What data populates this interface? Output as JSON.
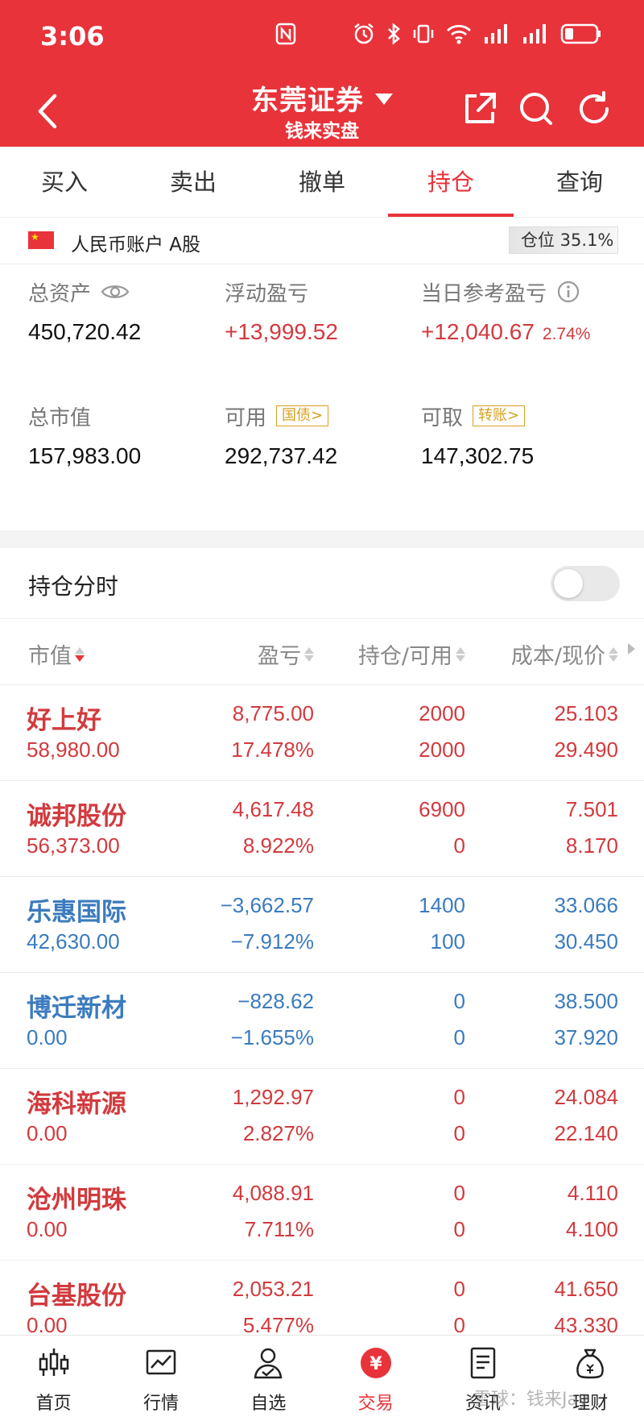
{
  "status_bar": {
    "time": "3:06"
  },
  "header": {
    "title": "东莞证券",
    "subtitle": "钱来实盘"
  },
  "tabs": [
    {
      "label": "买入",
      "active": false
    },
    {
      "label": "卖出",
      "active": false
    },
    {
      "label": "撤单",
      "active": false
    },
    {
      "label": "持仓",
      "active": true
    },
    {
      "label": "查询",
      "active": false
    }
  ],
  "account": {
    "label": "人民币账户 A股",
    "position_ratio": "仓位 35.1%"
  },
  "summary": {
    "total_assets_label": "总资产",
    "total_assets": "450,720.42",
    "floating_pl_label": "浮动盈亏",
    "floating_pl": "+13,999.52",
    "daily_pl_label": "当日参考盈亏",
    "daily_pl": "+12,040.67",
    "daily_pl_pct": "2.74%",
    "market_value_label": "总市值",
    "market_value": "157,983.00",
    "available_label": "可用",
    "available_tag": "国债>",
    "available": "292,737.42",
    "withdrawable_label": "可取",
    "withdrawable_tag": "转账>",
    "withdrawable": "147,302.75"
  },
  "timeshare": {
    "label": "持仓分时",
    "enabled": false
  },
  "table": {
    "headers": {
      "market_value": "市值",
      "pl": "盈亏",
      "holding": "持仓/可用",
      "cost": "成本/现价"
    },
    "rows": [
      {
        "name": "好上好",
        "mv": "58,980.00",
        "pl": "8,775.00",
        "pl_pct": "17.478%",
        "hold": "2000",
        "avail": "2000",
        "cost": "25.103",
        "price": "29.490",
        "color": "red"
      },
      {
        "name": "诚邦股份",
        "mv": "56,373.00",
        "pl": "4,617.48",
        "pl_pct": "8.922%",
        "hold": "6900",
        "avail": "0",
        "cost": "7.501",
        "price": "8.170",
        "color": "red"
      },
      {
        "name": "乐惠国际",
        "mv": "42,630.00",
        "pl": "−3,662.57",
        "pl_pct": "−7.912%",
        "hold": "1400",
        "avail": "100",
        "cost": "33.066",
        "price": "30.450",
        "color": "blue"
      },
      {
        "name": "博迁新材",
        "mv": "0.00",
        "pl": "−828.62",
        "pl_pct": "−1.655%",
        "hold": "0",
        "avail": "0",
        "cost": "38.500",
        "price": "37.920",
        "color": "blue"
      },
      {
        "name": "海科新源",
        "mv": "0.00",
        "pl": "1,292.97",
        "pl_pct": "2.827%",
        "hold": "0",
        "avail": "0",
        "cost": "24.084",
        "price": "22.140",
        "color": "red"
      },
      {
        "name": "沧州明珠",
        "mv": "0.00",
        "pl": "4,088.91",
        "pl_pct": "7.711%",
        "hold": "0",
        "avail": "0",
        "cost": "4.110",
        "price": "4.100",
        "color": "red"
      },
      {
        "name": "台基股份",
        "mv": "0.00",
        "pl": "2,053.21",
        "pl_pct": "5.477%",
        "hold": "0",
        "avail": "0",
        "cost": "41.650",
        "price": "43.330",
        "color": "red"
      }
    ]
  },
  "bottom_nav": [
    {
      "label": "首页",
      "icon": "candlestick-icon"
    },
    {
      "label": "行情",
      "icon": "chart-icon"
    },
    {
      "label": "自选",
      "icon": "user-check-icon"
    },
    {
      "label": "交易",
      "icon": "yuan-icon",
      "yuan": "¥"
    },
    {
      "label": "资讯",
      "icon": "document-icon"
    },
    {
      "label": "理财",
      "icon": "money-bag-icon"
    }
  ],
  "watermark": "雪球：钱来Jay",
  "colors": {
    "brand_red": "#e8333a",
    "profit_red": "#d23a3e",
    "loss_blue": "#3b7bbe",
    "tag_gold": "#d8a020"
  }
}
